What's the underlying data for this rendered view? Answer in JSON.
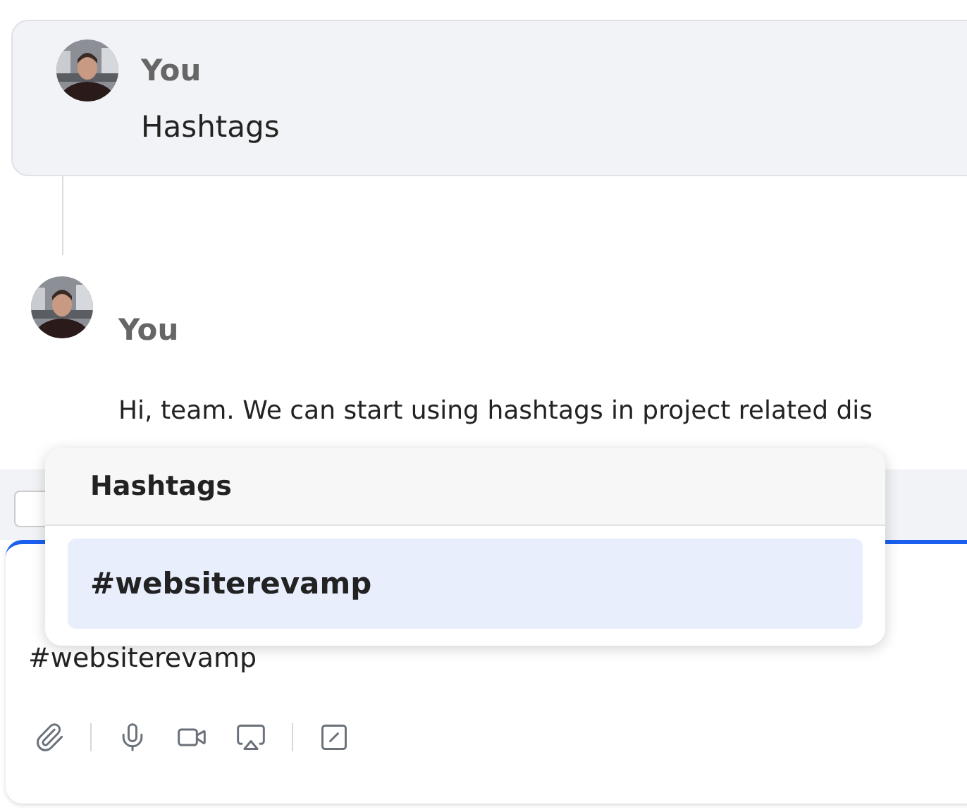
{
  "thread": {
    "parent": {
      "author": "You",
      "text": "Hashtags"
    },
    "reply": {
      "author": "You",
      "text": "Hi, team. We can start using hashtags in project related dis"
    }
  },
  "composer": {
    "value": "#websiterevamp",
    "tools": [
      {
        "kind": "attach"
      },
      {
        "kind": "divider"
      },
      {
        "kind": "mic"
      },
      {
        "kind": "video"
      },
      {
        "kind": "share"
      },
      {
        "kind": "divider"
      },
      {
        "kind": "slash"
      }
    ]
  },
  "hashtag_popup": {
    "title": "Hashtags",
    "items": [
      {
        "label": "#websiterevamp",
        "selected": true
      }
    ]
  }
}
